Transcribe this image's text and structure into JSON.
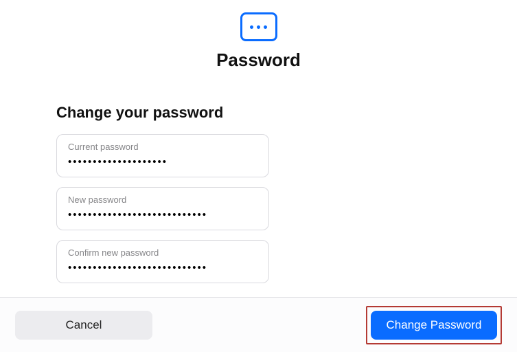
{
  "header": {
    "title": "Password"
  },
  "form": {
    "section_title": "Change your password",
    "fields": {
      "current": {
        "label": "Current password",
        "value": "••••••••••••••••••••"
      },
      "new": {
        "label": "New password",
        "value": "••••••••••••••••••••••••••••"
      },
      "confirm": {
        "label": "Confirm new password",
        "value": "••••••••••••••••••••••••••••"
      }
    }
  },
  "footer": {
    "cancel_label": "Cancel",
    "submit_label": "Change Password"
  }
}
